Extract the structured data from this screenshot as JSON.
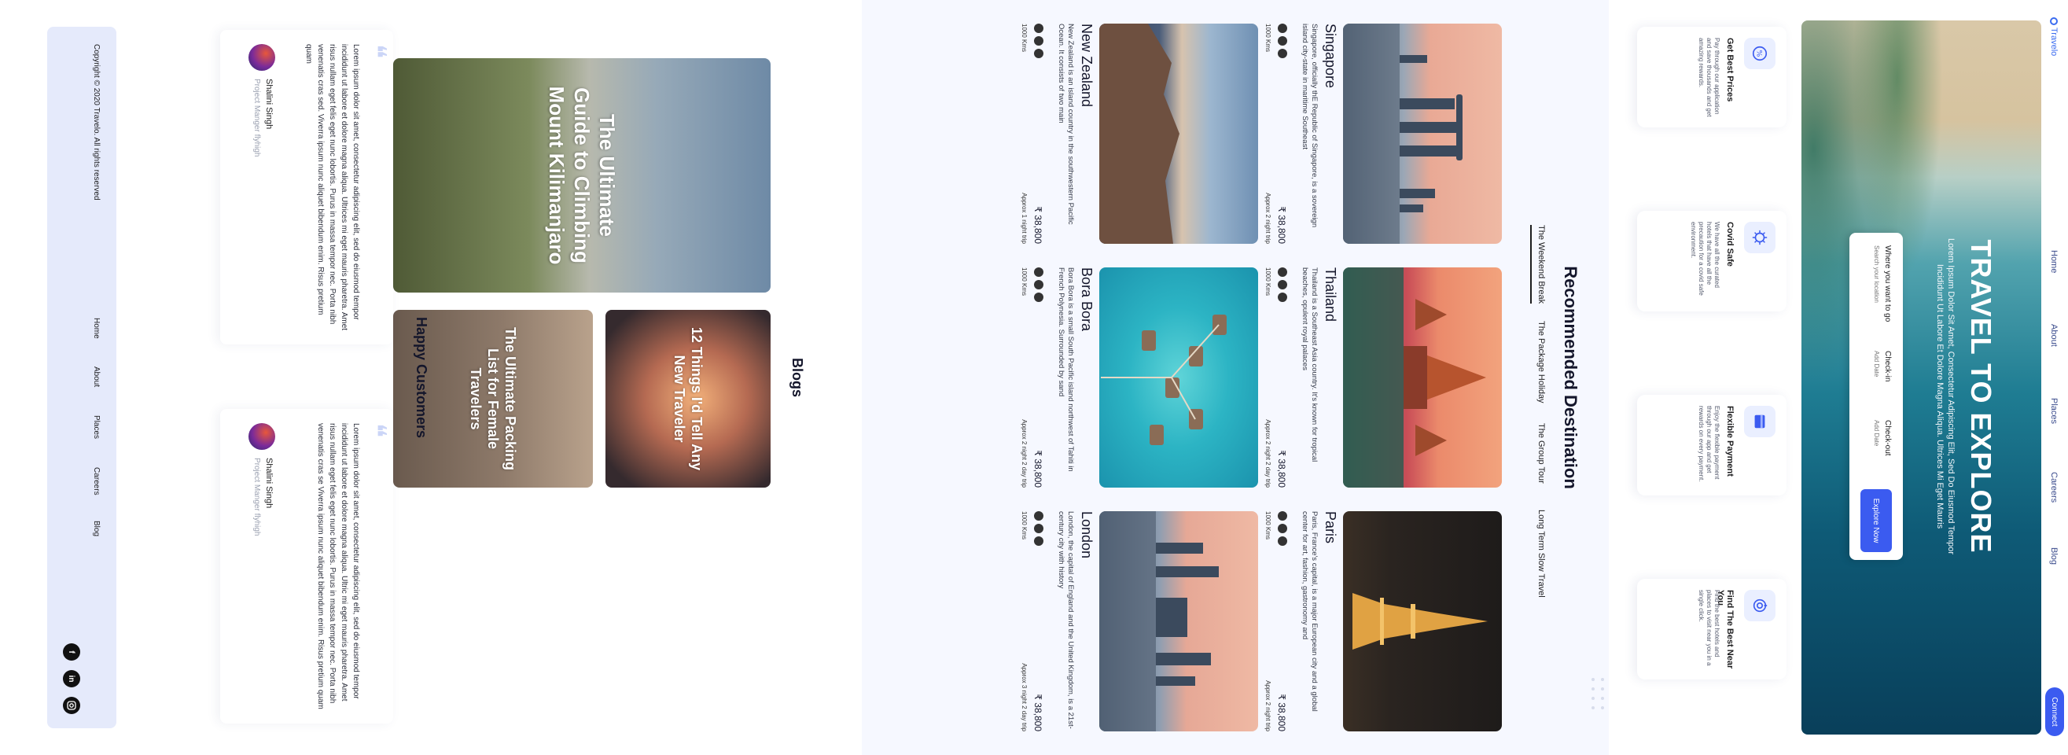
{
  "nav": {
    "logo": "Travelo",
    "links": [
      "Home",
      "About",
      "Places",
      "Careers",
      "Blog"
    ],
    "connect": "Connect"
  },
  "hero": {
    "title": "TRAVEL TO EXPLORE",
    "subtitle": "Lorem Ipsum Dolor Sit Amet, Consectetur Adipiscing Elit, Sed Do Eiusmod Tempor Incididunt Ut Labore Et Dolore Magna Aliqua. Ultrices Mi Eget Mauris",
    "search": {
      "where_label": "Where you want to go",
      "where_placeholder": "Search your location",
      "checkin_label": "Check-in",
      "checkin_placeholder": "Add Date",
      "checkout_label": "Check-out",
      "checkout_placeholder": "Add Date",
      "explore_button": "Explore Now"
    }
  },
  "features": [
    {
      "title": "Get Best Prices",
      "desc": "Pay through our application and save thousands and get amazing rewards.",
      "icon": "price-badge-icon"
    },
    {
      "title": "Covid Safe",
      "desc": "We have all the curated hotels that have all the precaution for a covid safe environment.",
      "icon": "virus-shield-icon"
    },
    {
      "title": "Flexible Payment",
      "desc": "Enjoy the flexible payment through our app and get rewards on every payment.",
      "icon": "card-icon"
    },
    {
      "title": "Find The Best Near You",
      "desc": "Find the best hotels and places to visit near you in a single click.",
      "icon": "location-target-icon"
    }
  ],
  "recommended": {
    "title": "Recommended Destination",
    "tabs": [
      "The Weekend Break",
      "The Package Holiday",
      "The Group Tour",
      "Long Term Slow Travel"
    ],
    "active_tab": 0,
    "destinations": [
      {
        "name": "Singapore",
        "desc": "Singapore, officially thE Republic of Singapore, is a sovereign island city-state in maritime Southeast",
        "price": "₹ 38,800",
        "distance": "1000 Kms",
        "trip": "Approx 2 night trip"
      },
      {
        "name": "Thailand",
        "desc": "Thailand is a Southeast Asia country. It's known for tropical beaches, opulent royal palaces",
        "price": "₹ 38,800",
        "distance": "1000 Kms",
        "trip": "Approx 2 night 2 day trip"
      },
      {
        "name": "Paris",
        "desc": "Paris, France's capital, is a major European city and a global center for art, fashion, gastronomy and",
        "price": "₹ 38,800",
        "distance": "1000 Kms",
        "trip": "Approx 2 night trip"
      },
      {
        "name": "New Zealand",
        "desc": "New Zealand is an island country in the southwestern Pacific Ocean. It consists of two main",
        "price": "₹ 38,800",
        "distance": "1000 Kms",
        "trip": "Approx 1 night trip"
      },
      {
        "name": "Bora Bora",
        "desc": "Bora Bora is a small South Pacific island northwest of Tahiti in French Polynesia. Surrounded by sand",
        "price": "₹ 38,800",
        "distance": "1000 Kms",
        "trip": "Approx 2 night 2 day trip"
      },
      {
        "name": "London",
        "desc": "London, the capital of England and the United Kingdom, is a 21st-century city with history",
        "price": "₹ 38,800",
        "distance": "1000 Kms",
        "trip": "Approx 3 night 2 day trip"
      }
    ]
  },
  "blogs": {
    "title": "Blogs",
    "posts": [
      "The Ultimate Guide to Climbing Mount Kilimanjaro",
      "12 Things I'd Tell Any New Traveler",
      "The Ultimate Packing List for Female Travelers"
    ]
  },
  "customers": {
    "title": "Happy Customers",
    "testimonials": [
      {
        "text": "Lorem ipsum dolor sit amet, consectetur adipiscing elit, sed do eiusmod tempor incididunt ut labore et dolore magna aliqua. Ultrices mi eget mauris pharetra. Amet risus nullam eget felis eget nunc lobortis. Purus in massa tempor nec. Porta nibh venenatis cras sed. Viverra ipsum nunc aliquet bibendum enim. Risus pretium quam",
        "name": "Shalini Singh",
        "role": "Project Manger flyhigh"
      },
      {
        "text": "Lorem ipsum dolor sit amet, consectetur adipiscing elit, sed do eiusmod tempor incididunt ut labore et dolore magna aliqua. Ultric mi eget mauris pharetra. Amet risus nullam eget felis eget nunc lobortis. Purus in massa tempor nec. Porta nibh venenatis cras se Viverra ipsum nunc aliquet bibendum enim. Risus pretium quam",
        "name": "Shalini Singh",
        "role": "Project Manger flyhigh"
      }
    ]
  },
  "footer": {
    "copyright": "Copyright © 2020 Travelo. All rights reserved",
    "links": [
      "Home",
      "About",
      "Places",
      "Careers",
      "Blog"
    ],
    "social": [
      "facebook-icon",
      "linkedin-icon",
      "instagram-icon"
    ]
  },
  "colors": {
    "accent": "#3b5bf0",
    "footer_bg": "#e5eafb",
    "section_bg": "#f6f8ff"
  }
}
